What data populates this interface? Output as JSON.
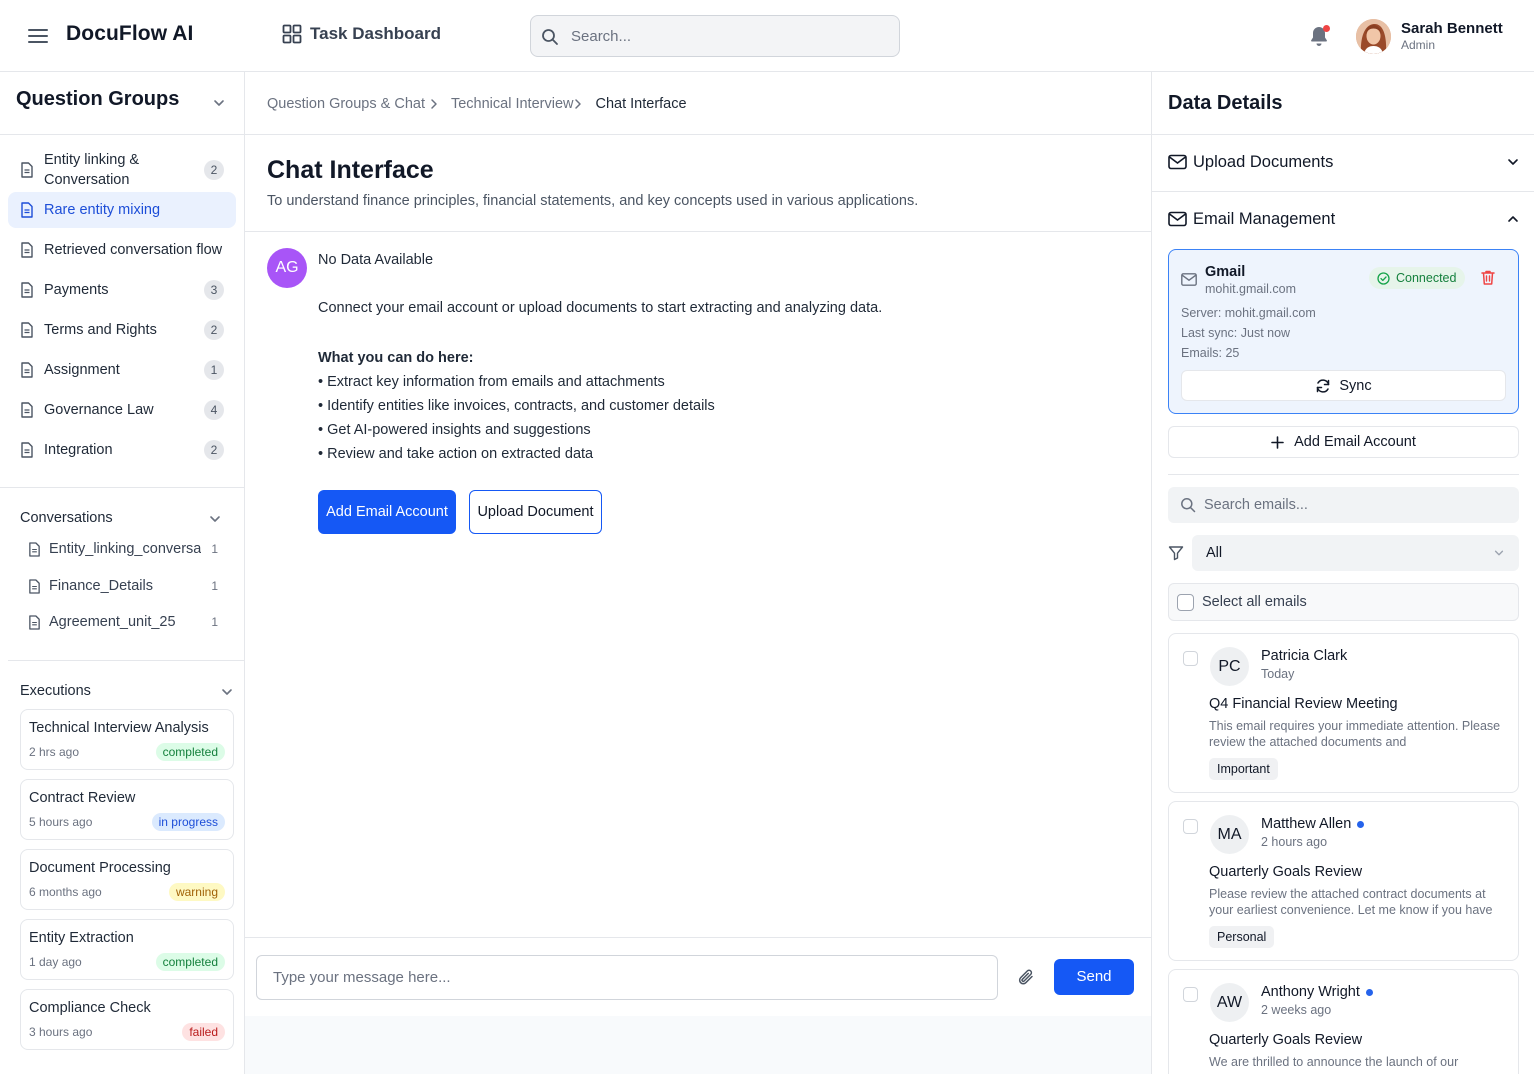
{
  "header": {
    "brand": "DocuFlow AI",
    "nav_label": "Task Dashboard",
    "search_placeholder": "Search...",
    "user": {
      "name": "Sarah Bennett",
      "role": "Admin"
    }
  },
  "sidebar": {
    "title": "Question Groups",
    "groups": [
      {
        "label": "Entity linking & Conversation",
        "count": "2",
        "active": false
      },
      {
        "label": "Rare entity mixing",
        "count": "",
        "active": true
      },
      {
        "label": "Retrieved conversation flow",
        "count": "",
        "active": false
      },
      {
        "label": "Payments",
        "count": "3",
        "active": false
      },
      {
        "label": "Terms and Rights",
        "count": "2",
        "active": false
      },
      {
        "label": "Assignment",
        "count": "1",
        "active": false
      },
      {
        "label": "Governance Law",
        "count": "4",
        "active": false
      },
      {
        "label": "Integration",
        "count": "2",
        "active": false
      }
    ],
    "conversations_title": "Conversations",
    "conversations": [
      {
        "label": "Entity_linking_conversati",
        "count": "1"
      },
      {
        "label": "Finance_Details",
        "count": "1"
      },
      {
        "label": "Agreement_unit_25",
        "count": "1"
      }
    ],
    "executions_title": "Executions",
    "executions": [
      {
        "title": "Technical Interview Analysis",
        "time": "2 hrs ago",
        "status": "completed"
      },
      {
        "title": "Contract Review",
        "time": "5 hours ago",
        "status": "in progress"
      },
      {
        "title": "Document Processing",
        "time": "6 months ago",
        "status": "warning"
      },
      {
        "title": "Entity Extraction",
        "time": "1 day ago",
        "status": "completed"
      },
      {
        "title": "Compliance Check",
        "time": "3 hours ago",
        "status": "failed"
      }
    ]
  },
  "main": {
    "breadcrumbs": [
      "Question Groups & Chat",
      "Technical Interview",
      "Chat Interface"
    ],
    "title": "Chat Interface",
    "subtitle": "To understand finance principles, financial statements, and key concepts used in various applications.",
    "message": {
      "avatar": "AG",
      "heading": "No Data Available",
      "intro": "Connect your email account or upload documents to start extracting and analyzing data.",
      "list_title": "What you can do here:",
      "bullets": [
        "• Extract key information from emails and attachments",
        "• Identify entities like invoices, contracts, and customer details",
        "• Get AI-powered insights and suggestions",
        "• Review and take action on extracted data"
      ],
      "primary_button": "Add Email Account",
      "secondary_button": "Upload Document"
    },
    "composer": {
      "placeholder": "Type your message here...",
      "send_label": "Send"
    }
  },
  "details": {
    "title": "Data Details",
    "upload_label": "Upload Documents",
    "email_label": "Email Management",
    "account": {
      "name": "Gmail",
      "address": "mohit.gmail.com",
      "status": "Connected",
      "server": "Server: mohit.gmail.com",
      "last_sync": "Last sync: Just now",
      "emails": "Emails: 25",
      "sync_label": "Sync"
    },
    "add_account_label": "Add Email Account",
    "search_placeholder": "Search emails...",
    "filter_value": "All",
    "select_all_label": "Select all emails",
    "emails": [
      {
        "initials": "PC",
        "from": "Patricia Clark",
        "time": "Today",
        "unread": false,
        "subject": "Q4 Financial Review Meeting",
        "preview": "This email requires your immediate attention. Please review the attached documents and",
        "tag": "Important"
      },
      {
        "initials": "MA",
        "from": "Matthew Allen",
        "time": "2 hours ago",
        "unread": true,
        "subject": "Quarterly Goals Review",
        "preview": "Please review the attached contract documents at your earliest convenience. Let me know if you have",
        "tag": "Personal"
      },
      {
        "initials": "AW",
        "from": "Anthony Wright",
        "time": "2 weeks ago",
        "unread": true,
        "subject": "Quarterly Goals Review",
        "preview": "We are thrilled to announce the launch of our",
        "tag": ""
      }
    ]
  },
  "colors": {
    "accent": "#1558f5",
    "active_bg": "#eaf1fe",
    "avatar_purple": "#a855f7",
    "status_completed": "#15803d",
    "status_in_progress": "#1d4ed8",
    "status_warning": "#a16207",
    "status_failed": "#b91c1c"
  },
  "icons": [
    "menu-icon",
    "grid-icon",
    "search-icon",
    "bell-icon",
    "document-icon",
    "chevron-down-icon",
    "chevron-up-icon",
    "chevron-right-icon",
    "mail-icon",
    "check-circle-icon",
    "trash-icon",
    "refresh-icon",
    "plus-icon",
    "filter-icon",
    "paperclip-icon"
  ]
}
